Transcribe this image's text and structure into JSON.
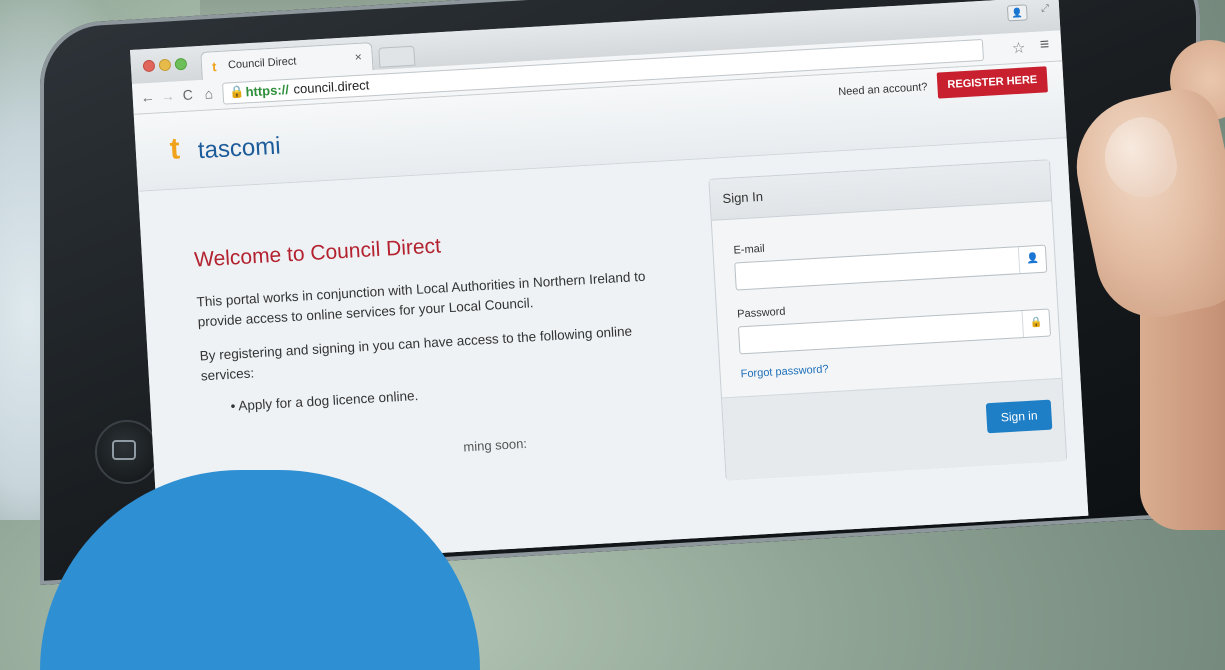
{
  "browser": {
    "tab_title": "Council Direct",
    "tab_close": "×",
    "url_https": "https://",
    "url_rest": "council.direct"
  },
  "icons": {
    "back": "←",
    "forward": "→",
    "reload": "C",
    "home": "⌂",
    "lock": "🔒",
    "star": "☆",
    "menu": "≡",
    "user": "👤",
    "user_field": "👤",
    "lock_field": "🔒",
    "tab_favicon": "t",
    "logo_mark": "t"
  },
  "header": {
    "logo_text": "tascomi",
    "need_account": "Need an account?",
    "register_label": "REGISTER HERE"
  },
  "main": {
    "welcome": "Welcome to Council Direct",
    "paragraph1": "This portal works in conjunction with Local Authorities in Northern Ireland to provide access to online services for your Local Council.",
    "paragraph2": "By registering and signing in you can have access to the following online services:",
    "bullets": [
      "• Apply for a dog licence online."
    ],
    "coming_soon": "ming soon:"
  },
  "signin": {
    "heading": "Sign In",
    "email_label": "E-mail",
    "password_label": "Password",
    "forgot_label": "Forgot password?",
    "button_label": "Sign in"
  },
  "colors": {
    "brand_red": "#c8202f",
    "brand_blue": "#1d5c9a",
    "button_blue": "#1f7fc6",
    "logo_orange": "#f0a21b"
  }
}
